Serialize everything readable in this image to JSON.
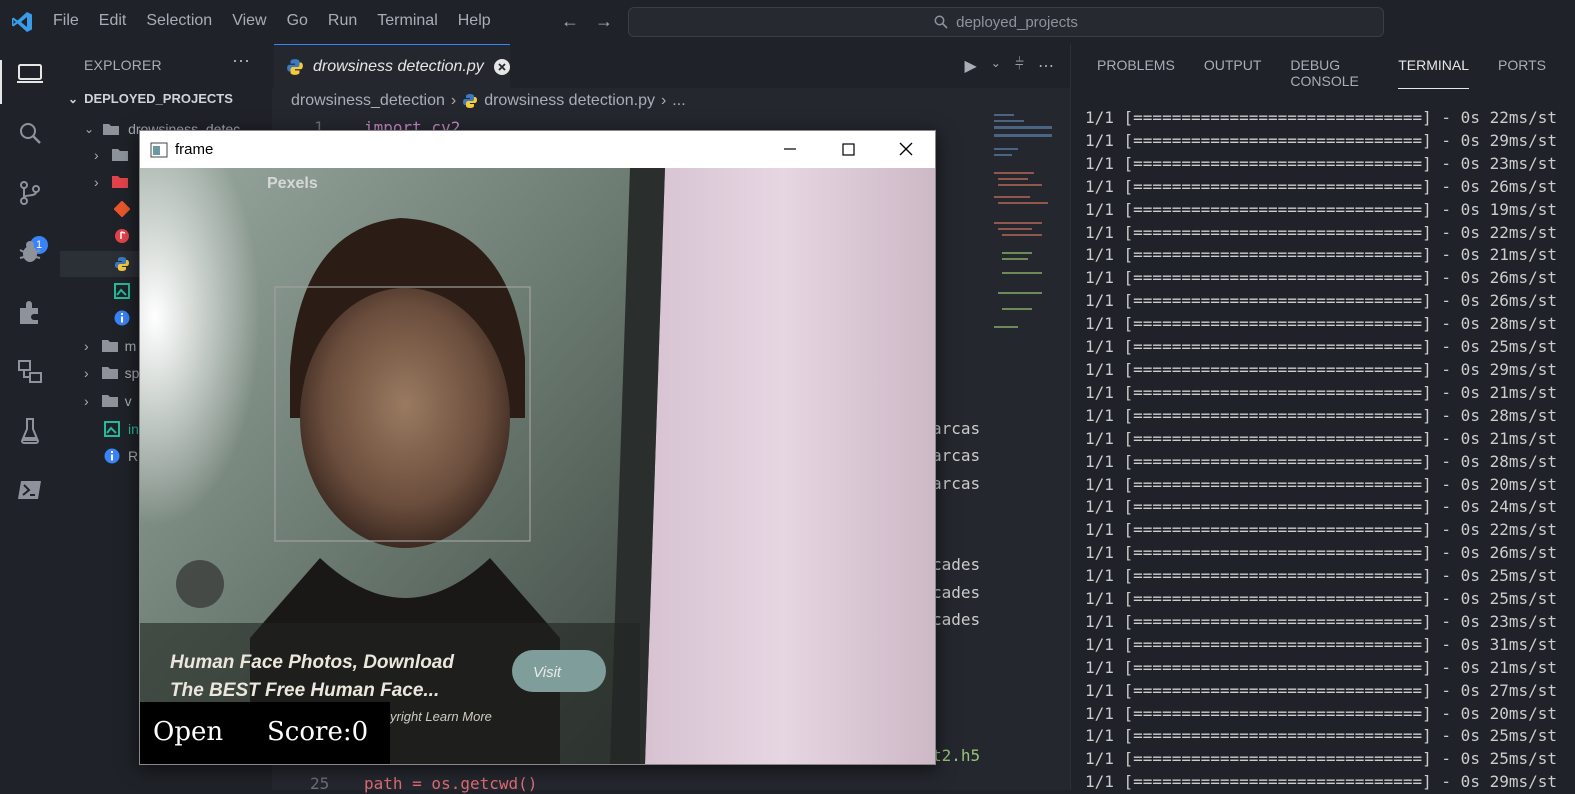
{
  "menu": [
    "File",
    "Edit",
    "Selection",
    "View",
    "Go",
    "Run",
    "Terminal",
    "Help"
  ],
  "search": {
    "text": "deployed_projects"
  },
  "activity_badge": "1",
  "explorer": {
    "title": "EXPLORER",
    "root": "DEPLOYED_PROJECTS",
    "folder": "drowsiness_detec",
    "partial_items": [
      "m",
      "sp",
      "v",
      "in",
      "R"
    ]
  },
  "editor": {
    "tab_label": "drowsiness detection.py",
    "breadcrumb": [
      "drowsiness_detection",
      "drowsiness detection.py",
      "..."
    ],
    "line1_num": "1",
    "line1_code": "import cv2",
    "line25_num": "25",
    "line25_code": "path = os.getcwd()",
    "visible_fragments": [
      "arcas",
      "arcas",
      "arcas",
      "cades",
      "cades",
      "cades",
      "t2.h5"
    ]
  },
  "panel": {
    "tabs": [
      "PROBLEMS",
      "OUTPUT",
      "DEBUG CONSOLE",
      "TERMINAL",
      "PORTS"
    ],
    "active_tab": "TERMINAL",
    "terminal_lines": [
      "1/1 [==============================] - 0s 22ms/st",
      "1/1 [==============================] - 0s 29ms/st",
      "1/1 [==============================] - 0s 23ms/st",
      "1/1 [==============================] - 0s 26ms/st",
      "1/1 [==============================] - 0s 19ms/st",
      "1/1 [==============================] - 0s 22ms/st",
      "1/1 [==============================] - 0s 21ms/st",
      "1/1 [==============================] - 0s 26ms/st",
      "1/1 [==============================] - 0s 26ms/st",
      "1/1 [==============================] - 0s 28ms/st",
      "1/1 [==============================] - 0s 25ms/st",
      "1/1 [==============================] - 0s 29ms/st",
      "1/1 [==============================] - 0s 21ms/st",
      "1/1 [==============================] - 0s 28ms/st",
      "1/1 [==============================] - 0s 21ms/st",
      "1/1 [==============================] - 0s 28ms/st",
      "1/1 [==============================] - 0s 20ms/st",
      "1/1 [==============================] - 0s 24ms/st",
      "1/1 [==============================] - 0s 22ms/st",
      "1/1 [==============================] - 0s 26ms/st",
      "1/1 [==============================] - 0s 25ms/st",
      "1/1 [==============================] - 0s 25ms/st",
      "1/1 [==============================] - 0s 23ms/st",
      "1/1 [==============================] - 0s 31ms/st",
      "1/1 [==============================] - 0s 21ms/st",
      "1/1 [==============================] - 0s 27ms/st",
      "1/1 [==============================] - 0s 20ms/st",
      "1/1 [==============================] - 0s 25ms/st",
      "1/1 [==============================] - 0s 25ms/st",
      "1/1 [==============================] - 0s 29ms/st"
    ]
  },
  "frame_window": {
    "title": "frame",
    "status_label": "Open",
    "score_label": "Score:0",
    "photo_ad_line1": "Human Face Photos, Download",
    "photo_ad_line2": "The BEST Free Human Face...",
    "photo_ad_small": "yright  Learn More",
    "photo_visit": "Visit",
    "photo_source": "Pexels"
  },
  "colors": {
    "accent": "#3a82f7",
    "bg": "#1f2228",
    "editor_bg": "#24272e"
  }
}
